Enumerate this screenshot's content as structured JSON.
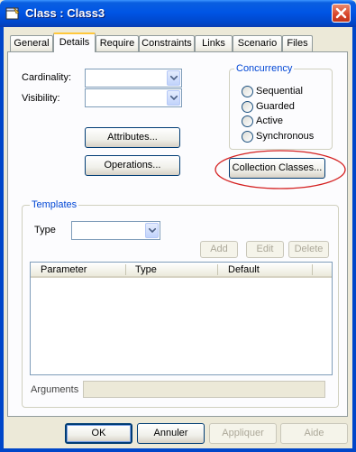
{
  "window": {
    "title": "Class : Class3",
    "icon": "class-diagram-icon",
    "close_icon": "close-icon"
  },
  "tabs": [
    {
      "label": "General",
      "active": false
    },
    {
      "label": "Details",
      "active": true
    },
    {
      "label": "Require",
      "active": false
    },
    {
      "label": "Constraints",
      "active": false
    },
    {
      "label": "Links",
      "active": false
    },
    {
      "label": "Scenario",
      "active": false
    },
    {
      "label": "Files",
      "active": false
    }
  ],
  "details": {
    "cardinality_label": "Cardinality:",
    "cardinality_value": "",
    "visibility_label": "Visibility:",
    "visibility_value": "",
    "attributes_button": "Attributes...",
    "operations_button": "Operations...",
    "collection_classes_button": "Collection Classes..."
  },
  "concurrency": {
    "legend": "Concurrency",
    "options": [
      "Sequential",
      "Guarded",
      "Active",
      "Synchronous"
    ],
    "selected": null
  },
  "templates": {
    "legend": "Templates",
    "type_label": "Type",
    "type_value": "",
    "add_button": "Add",
    "edit_button": "Edit",
    "delete_button": "Delete",
    "columns": [
      "Parameter",
      "Type",
      "Default"
    ],
    "rows": [],
    "arguments_label": "Arguments",
    "arguments_value": ""
  },
  "footer": {
    "ok": "OK",
    "cancel": "Annuler",
    "apply": "Appliquer",
    "help": "Aide"
  },
  "annotation": {
    "highlight_color": "#d42020"
  }
}
